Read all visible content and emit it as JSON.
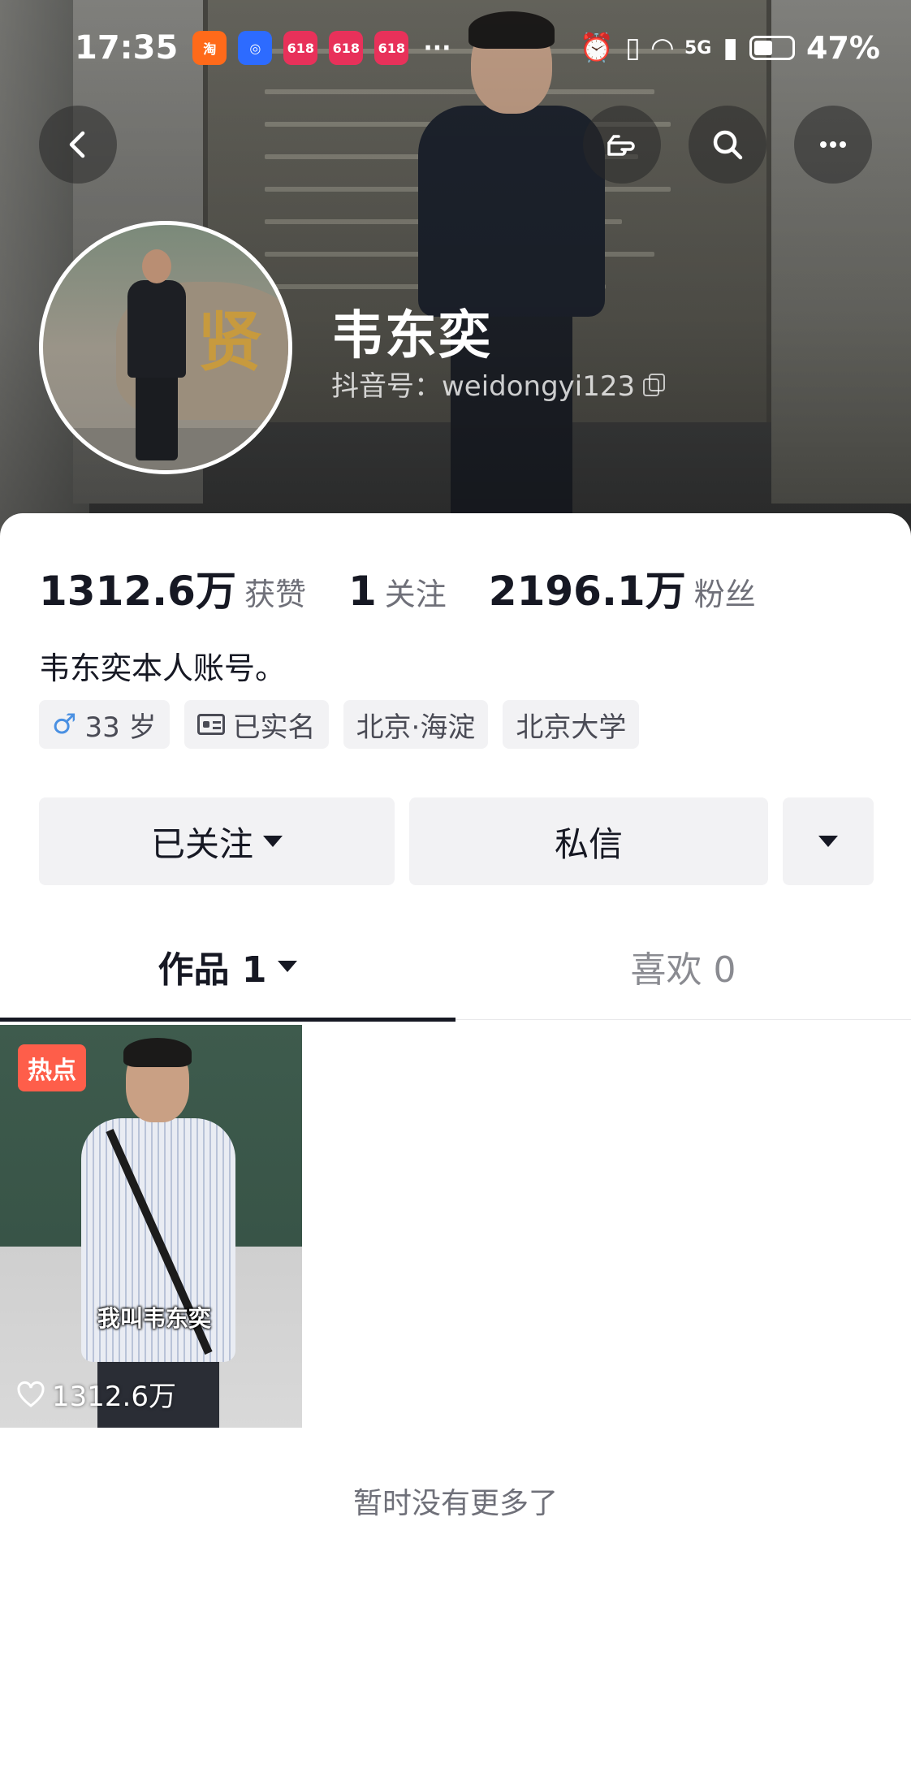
{
  "status_bar": {
    "time": "17:35",
    "network": "5G",
    "battery": "47%",
    "app_badges": [
      {
        "icon": "taobao-badge-icon",
        "color": "#ff6a1a"
      },
      {
        "icon": "assistant-badge-icon",
        "color": "#2d6bff"
      },
      {
        "icon": "618-badge-icon",
        "color": "#e8315a"
      },
      {
        "icon": "618-badge-icon",
        "color": "#e8315a"
      },
      {
        "icon": "618-badge-icon",
        "color": "#e8315a"
      }
    ],
    "more": "···"
  },
  "profile": {
    "name": "韦东奕",
    "douyin_id": "抖音号：weidongyi123"
  },
  "stats": [
    {
      "value": "1312.6万",
      "label": "获赞"
    },
    {
      "value": "1",
      "label": "关注"
    },
    {
      "value": "2196.1万",
      "label": "粉丝"
    }
  ],
  "bio": "韦东奕本人账号。",
  "tags": [
    {
      "icon": "male-icon",
      "text": "33 岁"
    },
    {
      "icon": "id-card-icon",
      "text": "已实名"
    },
    {
      "icon": "",
      "text": "北京·海淀"
    },
    {
      "icon": "",
      "text": "北京大学"
    }
  ],
  "actions": {
    "followed": "已关注",
    "message": "私信"
  },
  "tabs": [
    {
      "label": "作品 1",
      "active": true
    },
    {
      "label": "喜欢 0",
      "active": false
    }
  ],
  "videos": [
    {
      "badge": "热点",
      "caption": "我叫韦东奕",
      "likes": "1312.6万"
    }
  ],
  "footer_text": "暂时没有更多了",
  "colors": {
    "accent_hot": "#fe5e4a",
    "button_bg": "#f2f2f4",
    "text_primary": "#161823",
    "text_secondary": "#6f7079"
  }
}
